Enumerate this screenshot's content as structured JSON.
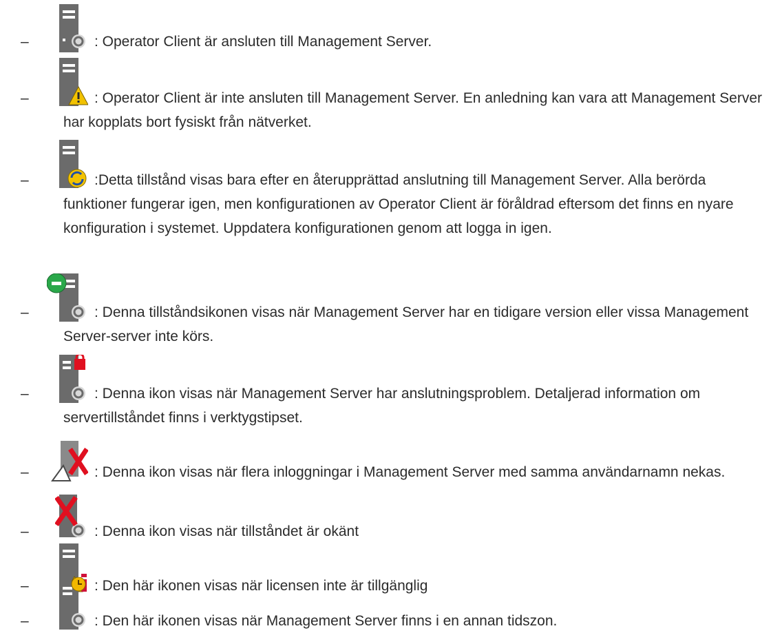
{
  "items": [
    {
      "icon": "server-connected-icon",
      "text": ": Operator Client är ansluten till Management Server."
    },
    {
      "icon": "server-disconnected-warning-icon",
      "text": ": Operator Client är inte ansluten till Management Server. En anledning kan vara att Management Server har kopplats bort fysiskt från nätverket."
    },
    {
      "icon": "server-reconnected-refresh-icon",
      "text": ":Detta tillstånd visas bara efter en återupprättad anslutning till Management Server. Alla berörda funktioner fungerar igen, men konfigurationen av Operator Client är föråldrad eftersom det finns en nyare konfiguration i systemet. Uppdatera konfigurationen genom att logga in igen."
    },
    {
      "icon": "server-older-version-icon",
      "text": ": Denna tillståndsikonen visas när Management Server har en tidigare version eller vissa Management Server-server inte körs."
    },
    {
      "icon": "server-connection-problem-lock-icon",
      "text": ": Denna ikon visas när Management Server har anslutningsproblem. Detaljerad information om servertillståndet finns i verktygstipset."
    },
    {
      "icon": "server-login-denied-icon",
      "text": ": Denna ikon visas när flera inloggningar i Management Server med samma användarnamn nekas."
    },
    {
      "icon": "server-unknown-state-icon",
      "text": ": Denna ikon visas när tillståndet är okänt"
    },
    {
      "icon": "server-license-unavailable-icon",
      "text": ": Den här ikonen visas när licensen inte är tillgänglig"
    },
    {
      "icon": "server-timezone-icon",
      "text": ": Den här ikonen visas när Management Server finns i en annan tidszon."
    }
  ],
  "dash": "–"
}
